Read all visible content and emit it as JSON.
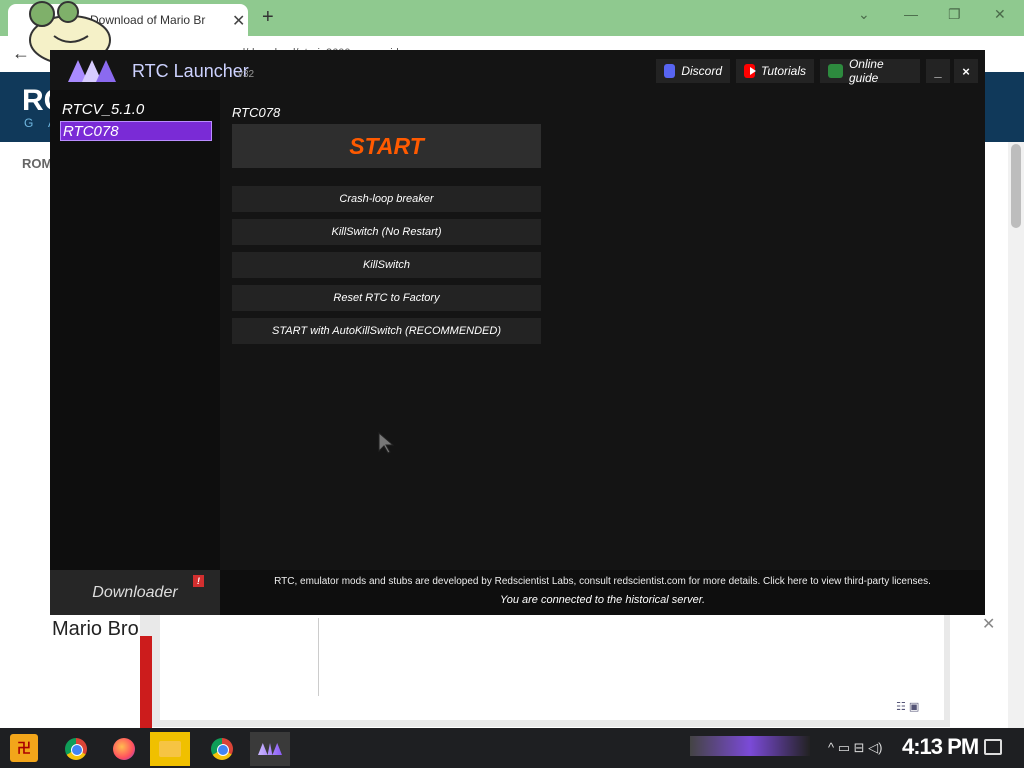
{
  "browser": {
    "tab_title": "Download of Mario Br",
    "tab_close": "✕",
    "new_tab": "+",
    "window_controls": [
      "⌄",
      "—",
      "❐",
      "✕"
    ],
    "back": "←",
    "forward": "→",
    "url_fragment": "...d/download/atari_2600_game_id..."
  },
  "site": {
    "logo": "RO",
    "logo_sub": "G A",
    "nav_label": "ROM",
    "heading": "Mario Bro",
    "ad_close": "✕",
    "ad_icons": "☷ ▣"
  },
  "launcher": {
    "title": "RTC Launcher",
    "version": "v32",
    "top_buttons": {
      "discord": "Discord",
      "tutorials": "Tutorials",
      "online_guide": "Online guide"
    },
    "minimize": "_",
    "close": "×",
    "versions": [
      {
        "label": "RTCV_5.1.0",
        "selected": false
      },
      {
        "label": "RTC078",
        "selected": true
      }
    ],
    "current_version": "RTC078",
    "start_label": "START",
    "actions": [
      "Crash-loop breaker",
      "KillSwitch (No Restart)",
      "KillSwitch",
      "Reset RTC to Factory",
      "START with AutoKillSwitch (RECOMMENDED)"
    ],
    "downloader_label": "Downloader",
    "downloader_badge": "!",
    "footer_line1": "RTC, emulator mods and stubs are developed by Redscientist Labs, consult redscientist.com for more details. Click here to view third-party licenses.",
    "footer_line2": "You are connected to the historical server."
  },
  "taskbar": {
    "start_glyph": "卍",
    "tray_icons": "^ ▭ ⊟ ◁)",
    "clock": "4:13 PM"
  },
  "colors": {
    "accent_purple": "#7a2bd6",
    "start_orange": "#ff5a00",
    "window_bg": "#141414"
  }
}
